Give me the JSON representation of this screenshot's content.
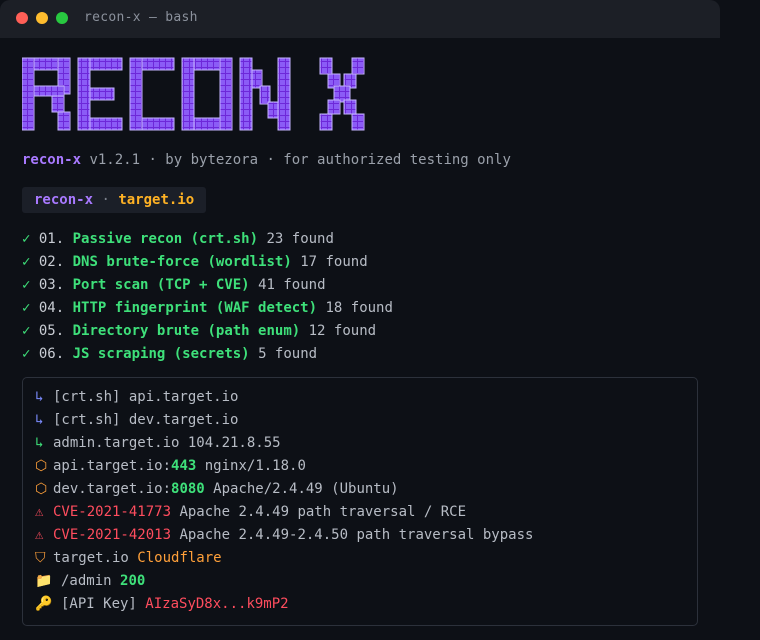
{
  "window": {
    "title": "recon-x — bash"
  },
  "logo": {
    "text": "RECON X",
    "colors": {
      "fill": "#7c3aed",
      "outline": "#c4b5fd"
    }
  },
  "tagline": {
    "brand": "recon-x",
    "rest": " v1.2.1 · by bytezora · for authorized testing only"
  },
  "prompt": {
    "tool": "recon-x",
    "separator": " · ",
    "target": "target.io"
  },
  "steps": [
    {
      "check": "✓",
      "num": "01.",
      "name": "Passive recon (crt.sh)",
      "found": "23 found"
    },
    {
      "check": "✓",
      "num": "02.",
      "name": "DNS brute-force (wordlist)",
      "found": "17 found"
    },
    {
      "check": "✓",
      "num": "03.",
      "name": "Port scan (TCP + CVE)",
      "found": "41 found"
    },
    {
      "check": "✓",
      "num": "04.",
      "name": "HTTP fingerprint (WAF detect)",
      "found": "18 found"
    },
    {
      "check": "✓",
      "num": "05.",
      "name": "Directory brute (path enum)",
      "found": "12 found"
    },
    {
      "check": "✓",
      "num": "06.",
      "name": "JS scraping (secrets)",
      "found": "5 found"
    }
  ],
  "results": [
    {
      "icon": "↳",
      "icon_name": "subdomain-arrow-icon",
      "parts": [
        "[crt.sh] api.target.io"
      ]
    },
    {
      "icon": "↳",
      "icon_name": "subdomain-arrow-icon",
      "parts": [
        "[crt.sh] dev.target.io"
      ]
    },
    {
      "icon": "↳",
      "icon_name": "subdomain-arrow-icon",
      "parts": [
        "admin.target.io 104.21.8.55"
      ]
    },
    {
      "icon": "⬡",
      "icon_name": "port-hexagon-icon",
      "host": "api.target.io:",
      "port": "443",
      "service": " nginx/1.18.0"
    },
    {
      "icon": "⬡",
      "icon_name": "port-hexagon-icon",
      "host": "dev.target.io:",
      "port": "8080",
      "service": " Apache/2.4.49 (Ubuntu)"
    },
    {
      "icon": "⚠",
      "icon_name": "warning-icon",
      "cve": "CVE-2021-41773",
      "desc": " Apache 2.4.49 path traversal / RCE"
    },
    {
      "icon": "⚠",
      "icon_name": "warning-icon",
      "cve": "CVE-2021-42013",
      "desc": " Apache 2.4.49-2.4.50 path traversal bypass"
    },
    {
      "icon": "⛉",
      "icon_name": "shield-icon",
      "host": "target.io ",
      "waf": "Cloudflare"
    },
    {
      "icon": "📁",
      "icon_name": "folder-icon",
      "path": "/admin ",
      "status": "200"
    },
    {
      "icon": "🔑",
      "icon_name": "key-icon",
      "label": "[API Key] ",
      "secret": "AIzaSyD8x...k9mP2"
    }
  ],
  "colors": {
    "accent_purple": "#a879ff",
    "accent_orange": "#ffb224",
    "success_green": "#3ee07a",
    "danger_red": "#ff4d5e"
  }
}
